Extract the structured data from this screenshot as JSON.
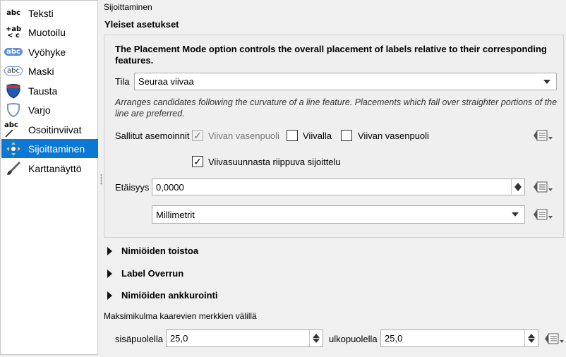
{
  "sidebar": {
    "items": [
      {
        "label": "Teksti",
        "icon": "text-abc-icon",
        "glyph": "abc"
      },
      {
        "label": "Muotoilu",
        "icon": "formatting-icon",
        "glyph": "+ab"
      },
      {
        "label": "Vyöhyke",
        "icon": "buffer-icon",
        "glyph": "abc"
      },
      {
        "label": "Maski",
        "icon": "mask-icon",
        "glyph": "abc"
      },
      {
        "label": "Tausta",
        "icon": "background-shield-icon",
        "glyph": ""
      },
      {
        "label": "Varjo",
        "icon": "shadow-icon",
        "glyph": ""
      },
      {
        "label": "Osoitinviivat",
        "icon": "callouts-icon",
        "glyph": "abc"
      },
      {
        "label": "Sijoittaminen",
        "icon": "placement-icon",
        "glyph": ""
      },
      {
        "label": "Karttanäyttö",
        "icon": "rendering-brush-icon",
        "glyph": ""
      }
    ],
    "selected": "Sijoittaminen"
  },
  "section_label": "Sijoittaminen",
  "general": {
    "title": "Yleiset asetukset",
    "info_text": "The Placement Mode option controls the overall placement of labels relative to their corresponding features.",
    "mode_label": "Tila",
    "mode_value": "Seuraa viivaa",
    "mode_description": "Arranges candidates following the curvature of a line feature. Placements which fall over straighter portions of the line are preferred.",
    "allowed_label": "Sallitut asemoinnit",
    "positions": [
      {
        "label": "Viivan vasenpuoli",
        "checked": true,
        "disabled": true
      },
      {
        "label": "Viivalla",
        "checked": false,
        "disabled": false
      },
      {
        "label": "Viivan vasenpuoli",
        "checked": false,
        "disabled": false
      }
    ],
    "orientation_label": "Viivasuunnasta riippuva sijoittelu",
    "orientation_checked": true,
    "distance_label": "Etäisyys",
    "distance_value": "0,0000",
    "unit_value": "Millimetrit"
  },
  "collapsed_sections": [
    "Nimiöiden toistoa",
    "Label Overrun",
    "Nimiöiden ankkurointi"
  ],
  "max_angle": {
    "title": "Maksimikulma kaarevien merkkien välillä",
    "inside_label": "sisäpuolella",
    "inside_value": "25,0",
    "outside_label": "ulkopuolella",
    "outside_value": "25,0"
  },
  "colors": {
    "selection": "#0a78d4",
    "panel_bg": "#f0f0f0"
  }
}
